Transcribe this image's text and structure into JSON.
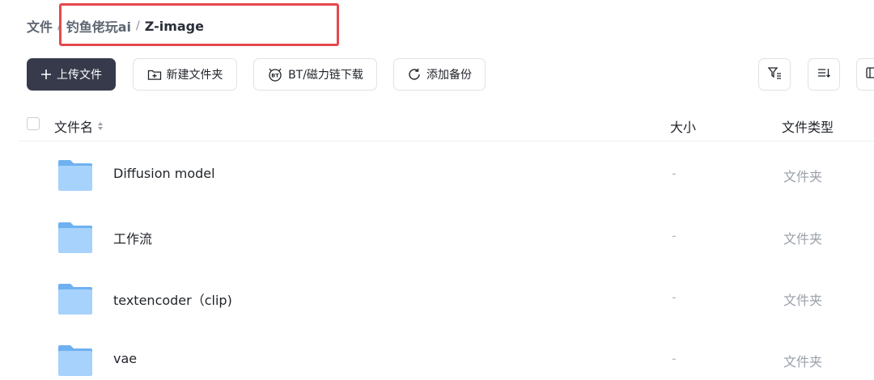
{
  "breadcrumb": {
    "items": [
      "文件",
      "钓鱼佬玩ai",
      "Z-image"
    ],
    "separator": "/"
  },
  "toolbar": {
    "upload_label": "上传文件",
    "new_folder_label": "新建文件夹",
    "bt_download_label": "BT/磁力链下载",
    "add_backup_label": "添加备份"
  },
  "table": {
    "columns": {
      "name": "文件名",
      "size": "大小",
      "type": "文件类型"
    },
    "rows": [
      {
        "name": "Diffusion model",
        "size": "-",
        "type": "文件夹",
        "icon": "folder-icon"
      },
      {
        "name": "工作流",
        "size": "-",
        "type": "文件夹",
        "icon": "folder-icon"
      },
      {
        "name": "textencoder（clip)",
        "size": "-",
        "type": "文件夹",
        "icon": "folder-icon"
      },
      {
        "name": "vae",
        "size": "-",
        "type": "文件夹",
        "icon": "folder-icon"
      }
    ]
  },
  "colors": {
    "primary_button": "#363a4b",
    "highlight_box": "#e5484d",
    "folder": "#8ec5f7"
  }
}
